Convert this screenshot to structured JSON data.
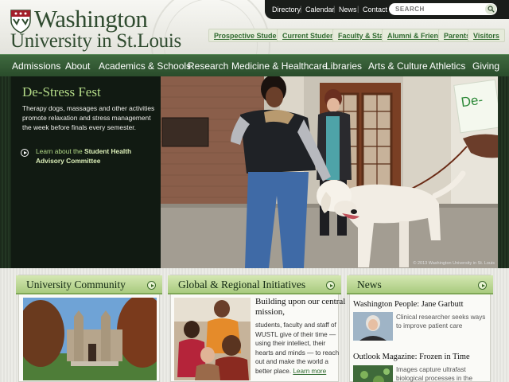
{
  "header": {
    "logo_line1": "Washington",
    "logo_line2": "University in St.Louis",
    "utility_links": [
      "Directory",
      "Calendar",
      "News",
      "Contact"
    ],
    "search_placeholder": "SEARCH",
    "audience_links": [
      "Prospective Students",
      "Current Students",
      "Faculty & Staff",
      "Alumni & Friends",
      "Parents",
      "Visitors"
    ]
  },
  "nav": {
    "items": [
      "Admissions",
      "About",
      "Academics & Schools",
      "Research",
      "Medicine & Healthcare",
      "Libraries",
      "Arts & Culture",
      "Athletics",
      "Giving"
    ]
  },
  "hero": {
    "title": "De-Stress Fest",
    "body": "Therapy dogs, massages and other activities promote relaxation and stress management the week before finals every semester.",
    "link_prefix": "Learn about the ",
    "link_bold": "Student Health Advisory Committee",
    "sign_text": "De-",
    "photo_credit": "© 2013 Washington University in St. Louis"
  },
  "panels": {
    "community": {
      "title": "University Community"
    },
    "global": {
      "title": "Global & Regional Initiatives",
      "headline": "Building upon our central mission,",
      "body": "students, faculty and staff of WUSTL give of their time — using their intellect, their hearts and minds — to reach out and make the world a better place.",
      "more": "Learn more"
    },
    "news": {
      "title": "News",
      "items": [
        {
          "headline": "Washington People: Jane Garbutt",
          "desc": "Clinical researcher seeks ways to improve patient care"
        },
        {
          "headline": "Outlook Magazine: Frozen in Time",
          "desc": "Images capture ultrafast biological processes in the"
        }
      ]
    }
  },
  "colors": {
    "brand_green": "#2f4b2f",
    "nav_green": "#2a4c2b",
    "hero_title": "#b4db88",
    "panel_head": "#a9cb7f"
  }
}
